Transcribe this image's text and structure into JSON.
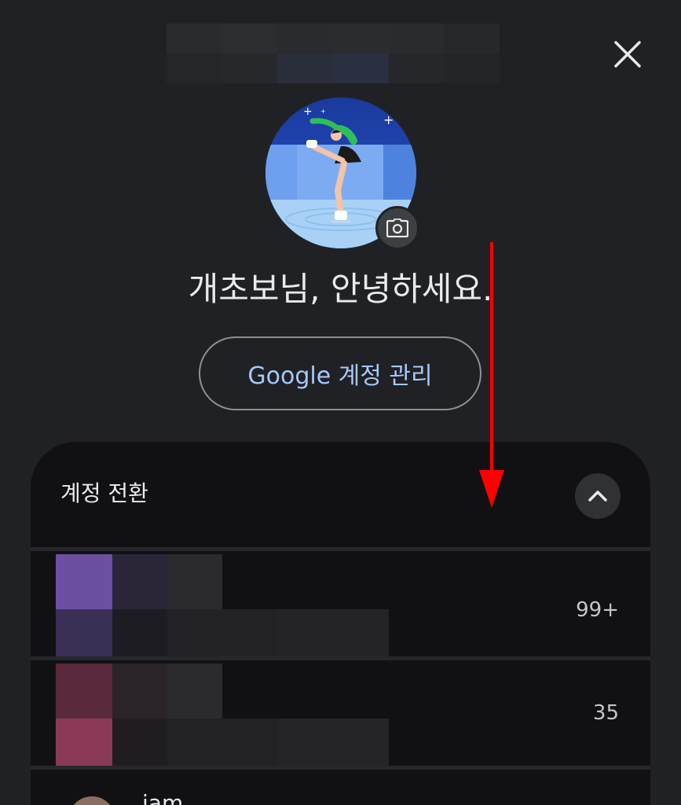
{
  "header": {
    "close_icon": "close-icon"
  },
  "profile": {
    "greeting": "개초보님, 안녕하세요.",
    "camera_icon": "camera-icon"
  },
  "manage_button": {
    "label": "Google 계정 관리",
    "color": "#a8c7fa"
  },
  "switch_accounts": {
    "title": "계정 전환",
    "collapse_icon": "chevron-up-icon",
    "accounts": [
      {
        "count": "99+"
      },
      {
        "count": "35"
      },
      {
        "name": "iam"
      }
    ]
  },
  "annotation": {
    "arrow_color": "#ff0000",
    "arrow_direction": "down"
  }
}
